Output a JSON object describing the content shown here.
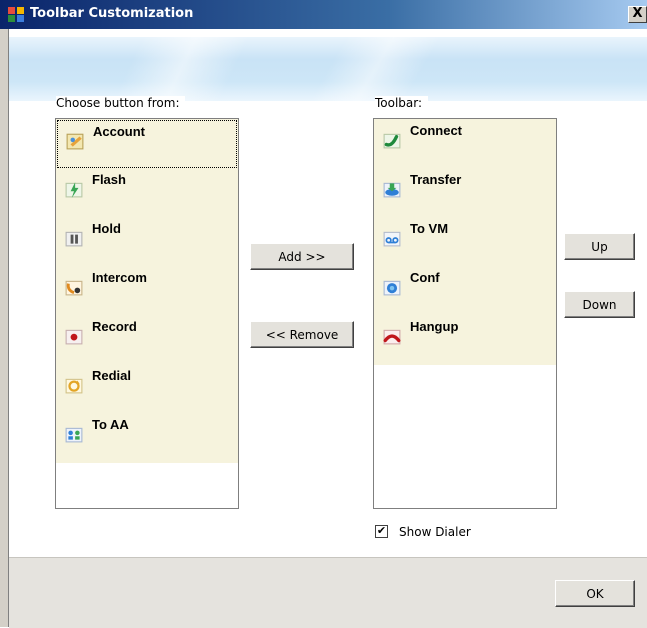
{
  "window": {
    "title": "Toolbar Customization",
    "close_label": "X"
  },
  "available": {
    "label": "Choose button from:",
    "items": [
      {
        "label": "Account",
        "icon": "account-icon",
        "selected": true
      },
      {
        "label": "Flash",
        "icon": "flash-icon"
      },
      {
        "label": "Hold",
        "icon": "hold-icon"
      },
      {
        "label": "Intercom",
        "icon": "intercom-icon"
      },
      {
        "label": "Record",
        "icon": "record-icon"
      },
      {
        "label": "Redial",
        "icon": "redial-icon"
      },
      {
        "label": "To AA",
        "icon": "to-aa-icon"
      }
    ]
  },
  "toolbar": {
    "label": "Toolbar:",
    "items": [
      {
        "label": "Connect",
        "icon": "connect-icon"
      },
      {
        "label": "Transfer",
        "icon": "transfer-icon"
      },
      {
        "label": "To VM",
        "icon": "to-vm-icon"
      },
      {
        "label": "Conf",
        "icon": "conf-icon"
      },
      {
        "label": "Hangup",
        "icon": "hangup-icon"
      }
    ]
  },
  "buttons": {
    "add": "Add >>",
    "remove": "<< Remove",
    "up": "Up",
    "down": "Down",
    "ok": "OK"
  },
  "options": {
    "show_dialer_label": "Show Dialer",
    "show_dialer_checked": true
  },
  "colors": {
    "list_background": "#f6f3dd",
    "title_bar": "#0a246a",
    "footer": "#e5e3de"
  }
}
